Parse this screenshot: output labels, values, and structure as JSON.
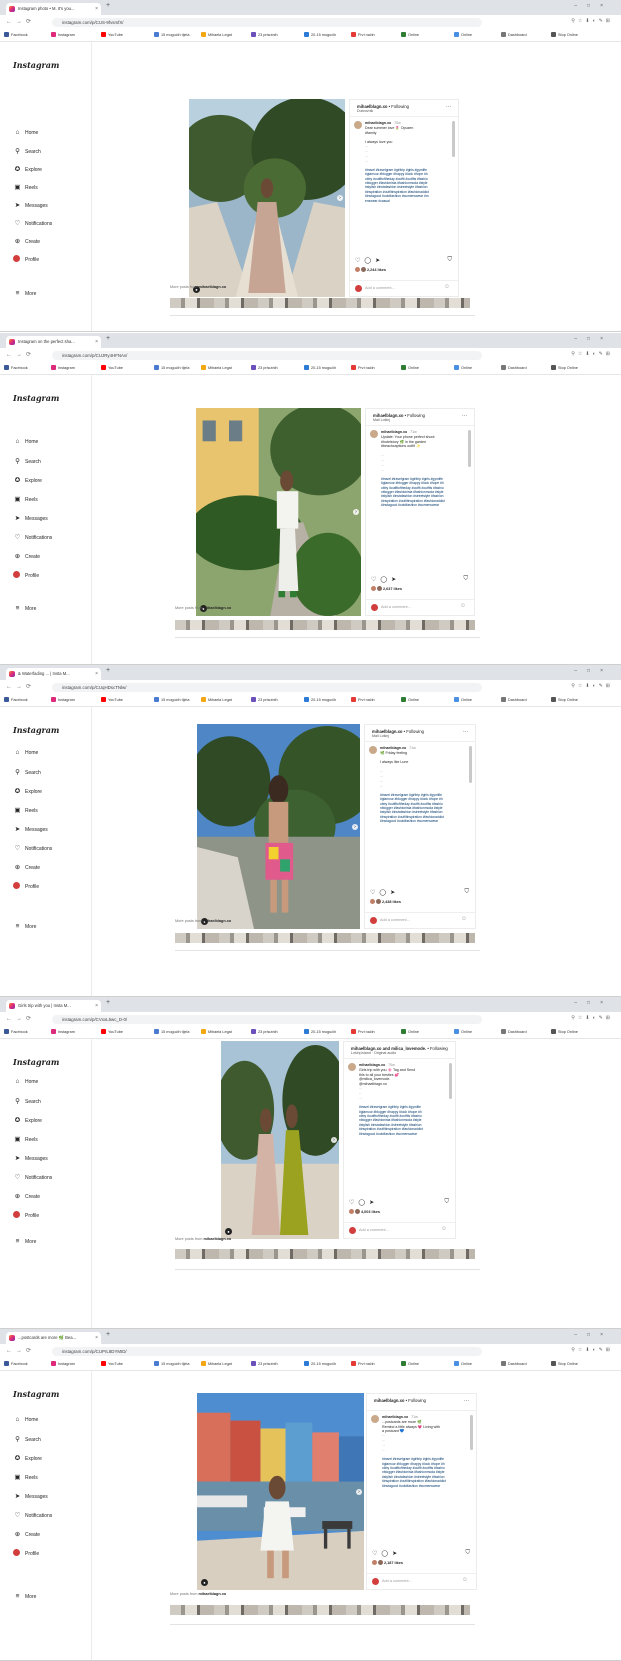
{
  "screens": [
    {
      "tab_title": "Instagram photo • M. It's you...",
      "url": "instagram.com/p/CUS-9fvsmfX/",
      "logo": "Instagram",
      "nav": [
        "Home",
        "Search",
        "Explore",
        "Reels",
        "Messages",
        "Notifications",
        "Create",
        "Profile"
      ],
      "more": "More",
      "username": "mihaelblagn.xo",
      "following": "• Following",
      "sub": "Dubrovnik",
      "caption_user": "mihaelblagn.xo",
      "time": "70w",
      "caption": "Dear summer love 🌷 Opuzen #family\n\nI always love you",
      "tags": "#travel #travelgram #girltrip #girls #gymlife #glamour #blogger #happy #look #hope #hobby #outfitoftheday #outfit #outfits #fashionblogger #fashionista #fashionmoda #style #stylish #instafashion #streetstyle #fashion #inspiration #outfitinspiration #fashionaddict #instagood #ootdfashion #womenswear #menswear #casual",
      "likes": "2,244 likes",
      "add_comment": "Add a comment...",
      "more_posts": "More posts from",
      "more_posts_user": "mihaelblagn.xo"
    },
    {
      "tab_title": "Instagram on the perfect sha...",
      "url": "instagram.com/p/CUJRy4HFNAv/",
      "logo": "Instagram",
      "nav": [
        "Home",
        "Search",
        "Explore",
        "Reels",
        "Messages",
        "Notifications",
        "Create",
        "Profile"
      ],
      "more": "More",
      "username": "mihaelblagn.xo",
      "following": "• Following",
      "sub": "Mali Lošinj",
      "caption_user": "mihaelblagn.xo",
      "time": "71w",
      "caption": "Update: Your phone perfect shoot\n#hotelstory 🌿 in the garden\n#beachcaptions outfit ✨",
      "tags": "#travel #travelgram #girltrip #girls #gymlife #glamour #blogger #happy #look #hope #hobby #outfitoftheday #outfit #outfits #fashionblogger #fashionista #fashionmoda #style #stylish #instafashion #streetstyle #fashion #inspiration #outfitinspiration #fashionaddict #instagood #ootdfashion #womenswear",
      "likes": "2,637 likes",
      "add_comment": "Add a comment...",
      "more_posts": "More posts from",
      "more_posts_user": "mihaelblagn.xo"
    },
    {
      "tab_title": "& Waterfading ... | Insta M...",
      "url": "instagram.com/p/CUqHDscTNlw/",
      "logo": "Instagram",
      "nav": [
        "Home",
        "Search",
        "Explore",
        "Reels",
        "Messages",
        "Notifications",
        "Create",
        "Profile"
      ],
      "more": "More",
      "username": "mihaelblagn.xo",
      "following": "• Following",
      "sub": "Mali Lošinj",
      "caption_user": "mihaelblagn.xo",
      "time": "71w",
      "caption": "🌿 Friday feeling\n\nI always like Lune",
      "tags": "#travel #travelgram #girltrip #girls #gymlife #glamour #blogger #happy #look #hope #hobby #outfitoftheday #outfit #outfits #fashionblogger #fashionista #fashionmoda #style #stylish #instafashion #streetstyle #fashion #inspiration #outfitinspiration #fashionaddict #instagood #ootdfashion #womenswear",
      "likes": "2,438 likes",
      "add_comment": "Add a comment...",
      "more_posts": "More posts from",
      "more_posts_user": "mihaelblagn.xo"
    },
    {
      "tab_title": "Girls trip with you | Insta M...",
      "url": "instagram.com/p/CVxxL5wc_D-0/",
      "logo": "Instagram",
      "nav": [
        "Home",
        "Search",
        "Explore",
        "Reels",
        "Messages",
        "Notifications",
        "Create",
        "Profile"
      ],
      "more": "More",
      "username": "mihaelblagn.xo and milica_lovemode.",
      "following": "• Following",
      "sub": "Lošinj island · Original audio",
      "caption_user": "mihaelblagn.xo",
      "time": "70w",
      "caption": "Girls trip with you 🌸 Tag and Send this to all your besties 💕\n@milica_lovemode. @mihaelblagn.xo",
      "tags": "#travel #travelgram #girltrip #girls #gymlife #glamour #blogger #happy #look #hope #hobby #outfitoftheday #outfit #outfits #fashionblogger #fashionista #fashionmoda #style #stylish #instafashion #streetstyle #fashion #inspiration #outfitinspiration #fashionaddict #instagood #ootdfashion #womenswear",
      "likes": "4,003 likes",
      "add_comment": "Add a comment...",
      "more_posts": "More posts from",
      "more_posts_user": "mihaelblagn.xo"
    },
    {
      "tab_title": "...postcards are more 🌿 Bea...",
      "url": "instagram.com/p/CUPrL8DYMID/",
      "logo": "Instagram",
      "nav": [
        "Home",
        "Search",
        "Explore",
        "Reels",
        "Messages",
        "Notifications",
        "Create",
        "Profile"
      ],
      "more": "More",
      "username": "mihaelblagn.xo",
      "following": "• Following",
      "sub": "",
      "caption_user": "mihaelblagn.xo",
      "time": "71w",
      "caption": "...postcards are more 🌿\nRemind a little always 💗 Living with a postcard 💙",
      "tags": "#travel #travelgram #girltrip #girls #gymlife #glamour #blogger #happy #look #hope #hobby #outfitoftheday #outfit #outfits #fashionblogger #fashionista #fashionmoda #style #stylish #instafashion #streetstyle #fashion #inspiration #outfitinspiration #fashionaddict #instagood #ootdfashion #womenswear",
      "likes": "2,187 likes",
      "add_comment": "Add a comment...",
      "more_posts": "More posts from",
      "more_posts_user": "mihaelblagn.xo"
    }
  ],
  "bookmarks": [
    "Facebook",
    "Instagram",
    "YouTube",
    "15 mogućih tijela",
    "Mihaela Legat",
    "23 prisutnih",
    "20-15 mogućih",
    "Prvi način",
    "Online",
    "Online",
    "Dashboard",
    "Stop Online"
  ],
  "caption_dots": "...\n...\n...\n...",
  "icons": {
    "home": "⌂",
    "search": "⚲",
    "explore": "✪",
    "reels": "▣",
    "messages": "➤",
    "notifications": "♡",
    "create": "⊕",
    "more": "≡",
    "like": "♡",
    "comment": "◯",
    "share": "➤",
    "save": "⛉",
    "emoji": "☺"
  },
  "colors": {
    "accent": "#0095f6",
    "link": "#00376b",
    "profile": "#d23d3d"
  }
}
